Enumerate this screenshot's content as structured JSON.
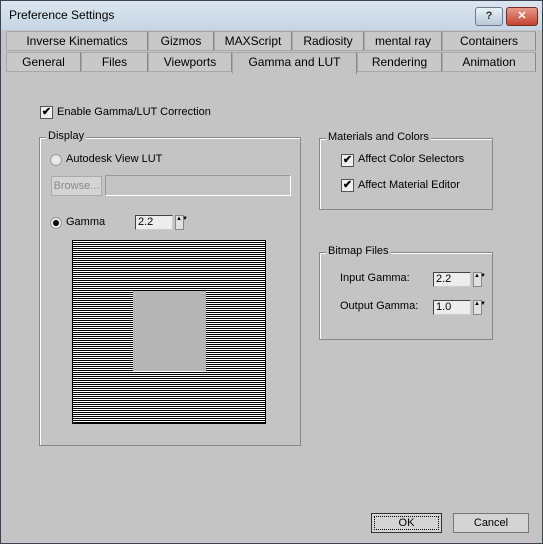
{
  "window": {
    "title": "Preference Settings",
    "help_label": "?",
    "close_label": "✕"
  },
  "tabs": {
    "row1": [
      {
        "label": "Inverse Kinematics"
      },
      {
        "label": "Gizmos"
      },
      {
        "label": "MAXScript"
      },
      {
        "label": "Radiosity"
      },
      {
        "label": "mental ray"
      },
      {
        "label": "Containers"
      }
    ],
    "row2": [
      {
        "label": "General"
      },
      {
        "label": "Files"
      },
      {
        "label": "Viewports"
      },
      {
        "label": "Gamma and LUT",
        "active": true
      },
      {
        "label": "Rendering"
      },
      {
        "label": "Animation"
      }
    ]
  },
  "gamma": {
    "enable_label": "Enable Gamma/LUT Correction",
    "enable_checked": true,
    "display": {
      "group_label": "Display",
      "lut_label": "Autodesk View LUT",
      "lut_selected": false,
      "browse_label": "Browse...",
      "lut_path": "",
      "gamma_label": "Gamma",
      "gamma_selected": true,
      "gamma_value": "2.2"
    },
    "materials": {
      "group_label": "Materials and Colors",
      "affect_color_label": "Affect Color Selectors",
      "affect_color_checked": true,
      "affect_material_label": "Affect Material Editor",
      "affect_material_checked": true
    },
    "bitmap": {
      "group_label": "Bitmap Files",
      "input_label": "Input Gamma:",
      "input_value": "2.2",
      "output_label": "Output Gamma:",
      "output_value": "1.0"
    }
  },
  "footer": {
    "ok_label": "OK",
    "cancel_label": "Cancel"
  },
  "check_glyph": "✔",
  "spin_glyph": "▲▼"
}
